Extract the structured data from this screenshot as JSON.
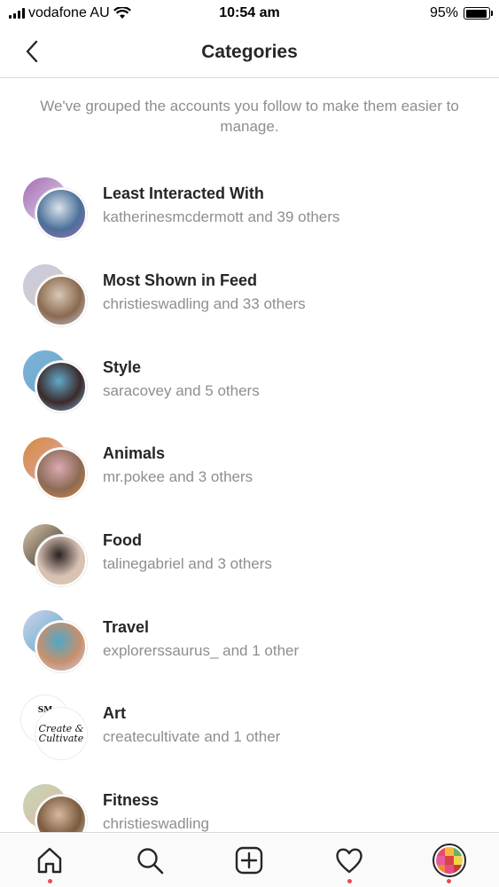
{
  "status_bar": {
    "carrier": "vodafone AU",
    "time": "10:54 am",
    "battery_percent": "95%",
    "battery_level": 0.95
  },
  "header": {
    "title": "Categories",
    "back_icon": "chevron-left-icon"
  },
  "subtitle": "We've grouped the accounts you follow to make them easier to manage.",
  "categories": [
    {
      "name": "Least Interacted With",
      "accounts": "katherinesmcdermott and 39 others",
      "colors": [
        "#a86ab6",
        "#dbe3ea",
        "#4a7099"
      ]
    },
    {
      "name": "Most Shown in Feed",
      "accounts": "christieswadling and 33 others",
      "colors": [
        "#c7cde6",
        "#d8c8b8",
        "#8a6a4e"
      ]
    },
    {
      "name": "Style",
      "accounts": "saracovey and 5 others",
      "colors": [
        "#7fb3d9",
        "#63a8c9",
        "#3b2a2a"
      ]
    },
    {
      "name": "Animals",
      "accounts": "mr.pokee and 3 others",
      "colors": [
        "#d68a3c",
        "#dca9b4",
        "#8c6b55"
      ]
    },
    {
      "name": "Food",
      "accounts": "talinegabriel and 3 others",
      "colors": [
        "#d9c7a8",
        "#2a2020",
        "#d8c2b4"
      ]
    },
    {
      "name": "Travel",
      "accounts": "explorerssaurus_ and 1 other",
      "colors": [
        "#cfd3ea",
        "#4fa7c8",
        "#c8906c"
      ]
    },
    {
      "name": "Art",
      "accounts": "createcultivate and 1 other",
      "colors": [
        "#ffffff",
        "#ffffff",
        "#111111"
      ]
    },
    {
      "name": "Fitness",
      "accounts": "christieswadling",
      "colors": [
        "#c9d6b8",
        "#d9b8a0",
        "#7a5a3e"
      ]
    }
  ],
  "art_logo": {
    "back_text": "SM",
    "front_text": "Create & Cultivate"
  },
  "tabbar": {
    "tabs": [
      {
        "icon": "home-icon",
        "has_dot": true
      },
      {
        "icon": "search-icon",
        "has_dot": false
      },
      {
        "icon": "add-post-icon",
        "has_dot": false
      },
      {
        "icon": "heart-icon",
        "has_dot": true
      },
      {
        "icon": "profile-avatar",
        "has_dot": true
      }
    ],
    "accent_color": "#ed4956"
  },
  "colors": {
    "text_primary": "#262626",
    "text_secondary": "#8e8e8e",
    "divider": "#dbdbdb"
  }
}
